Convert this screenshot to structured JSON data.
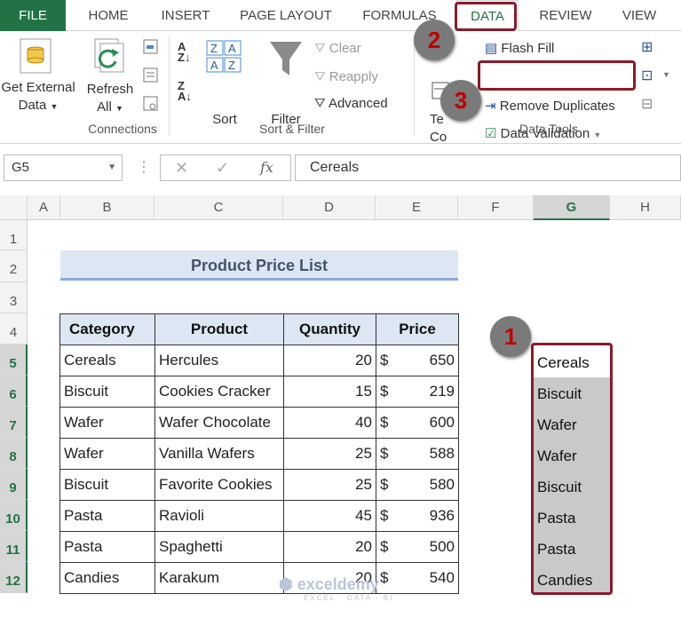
{
  "tabs": [
    "FILE",
    "HOME",
    "INSERT",
    "PAGE LAYOUT",
    "FORMULAS",
    "DATA",
    "REVIEW",
    "VIEW"
  ],
  "ribbon": {
    "get_external_line1": "Get External",
    "get_external_line2": "Data",
    "refresh_line1": "Refresh",
    "refresh_line2": "All",
    "sort": "Sort",
    "filter": "Filter",
    "clear": "Clear",
    "reapply": "Reapply",
    "advanced": "Advanced",
    "text_to_columns_a": "Te",
    "text_to_columns_b": "Co",
    "flash_fill": "Flash Fill",
    "remove_duplicates": "Remove Duplicates",
    "data_validation": "Data Validation",
    "group_connections": "Connections",
    "group_sort_filter": "Sort & Filter",
    "group_data_tools": "Data Tools"
  },
  "badges": [
    "1",
    "2",
    "3"
  ],
  "formula_bar": {
    "name_box": "G5",
    "fx": "fx",
    "value": "Cereals"
  },
  "columns": [
    "A",
    "B",
    "C",
    "D",
    "E",
    "F",
    "G",
    "H"
  ],
  "rows": [
    "1",
    "2",
    "3",
    "4",
    "5",
    "6",
    "7",
    "8",
    "9",
    "10",
    "11",
    "12"
  ],
  "sheet": {
    "title": "Product Price List",
    "headers": [
      "Category",
      "Product",
      "Quantity",
      "Price"
    ],
    "records": [
      {
        "category": "Cereals",
        "product": "Hercules",
        "quantity": "20",
        "cur": "$",
        "price": "650"
      },
      {
        "category": "Biscuit",
        "product": "Cookies Cracker",
        "quantity": "15",
        "cur": "$",
        "price": "219"
      },
      {
        "category": "Wafer",
        "product": "Wafer Chocolate",
        "quantity": "40",
        "cur": "$",
        "price": "600"
      },
      {
        "category": "Wafer",
        "product": "Vanilla Wafers",
        "quantity": "25",
        "cur": "$",
        "price": "588"
      },
      {
        "category": "Biscuit",
        "product": "Favorite Cookies",
        "quantity": "25",
        "cur": "$",
        "price": "580"
      },
      {
        "category": "Pasta",
        "product": "Ravioli",
        "quantity": "45",
        "cur": "$",
        "price": "936"
      },
      {
        "category": "Pasta",
        "product": "Spaghetti",
        "quantity": "20",
        "cur": "$",
        "price": "500"
      },
      {
        "category": "Candies",
        "product": "Karakum",
        "quantity": "20",
        "cur": "$",
        "price": "540"
      }
    ],
    "column_g": [
      "Cereals",
      "Biscuit",
      "Wafer",
      "Wafer",
      "Biscuit",
      "Pasta",
      "Pasta",
      "Candies"
    ]
  },
  "watermark": {
    "name": "exceldemy",
    "tagline": "EXCEL · DATA · BI"
  },
  "colors": {
    "excel_green": "#217346",
    "highlight_red": "#8b1a2a",
    "header_fill": "#dde7f3",
    "selection_gray": "#c9c9c9"
  }
}
